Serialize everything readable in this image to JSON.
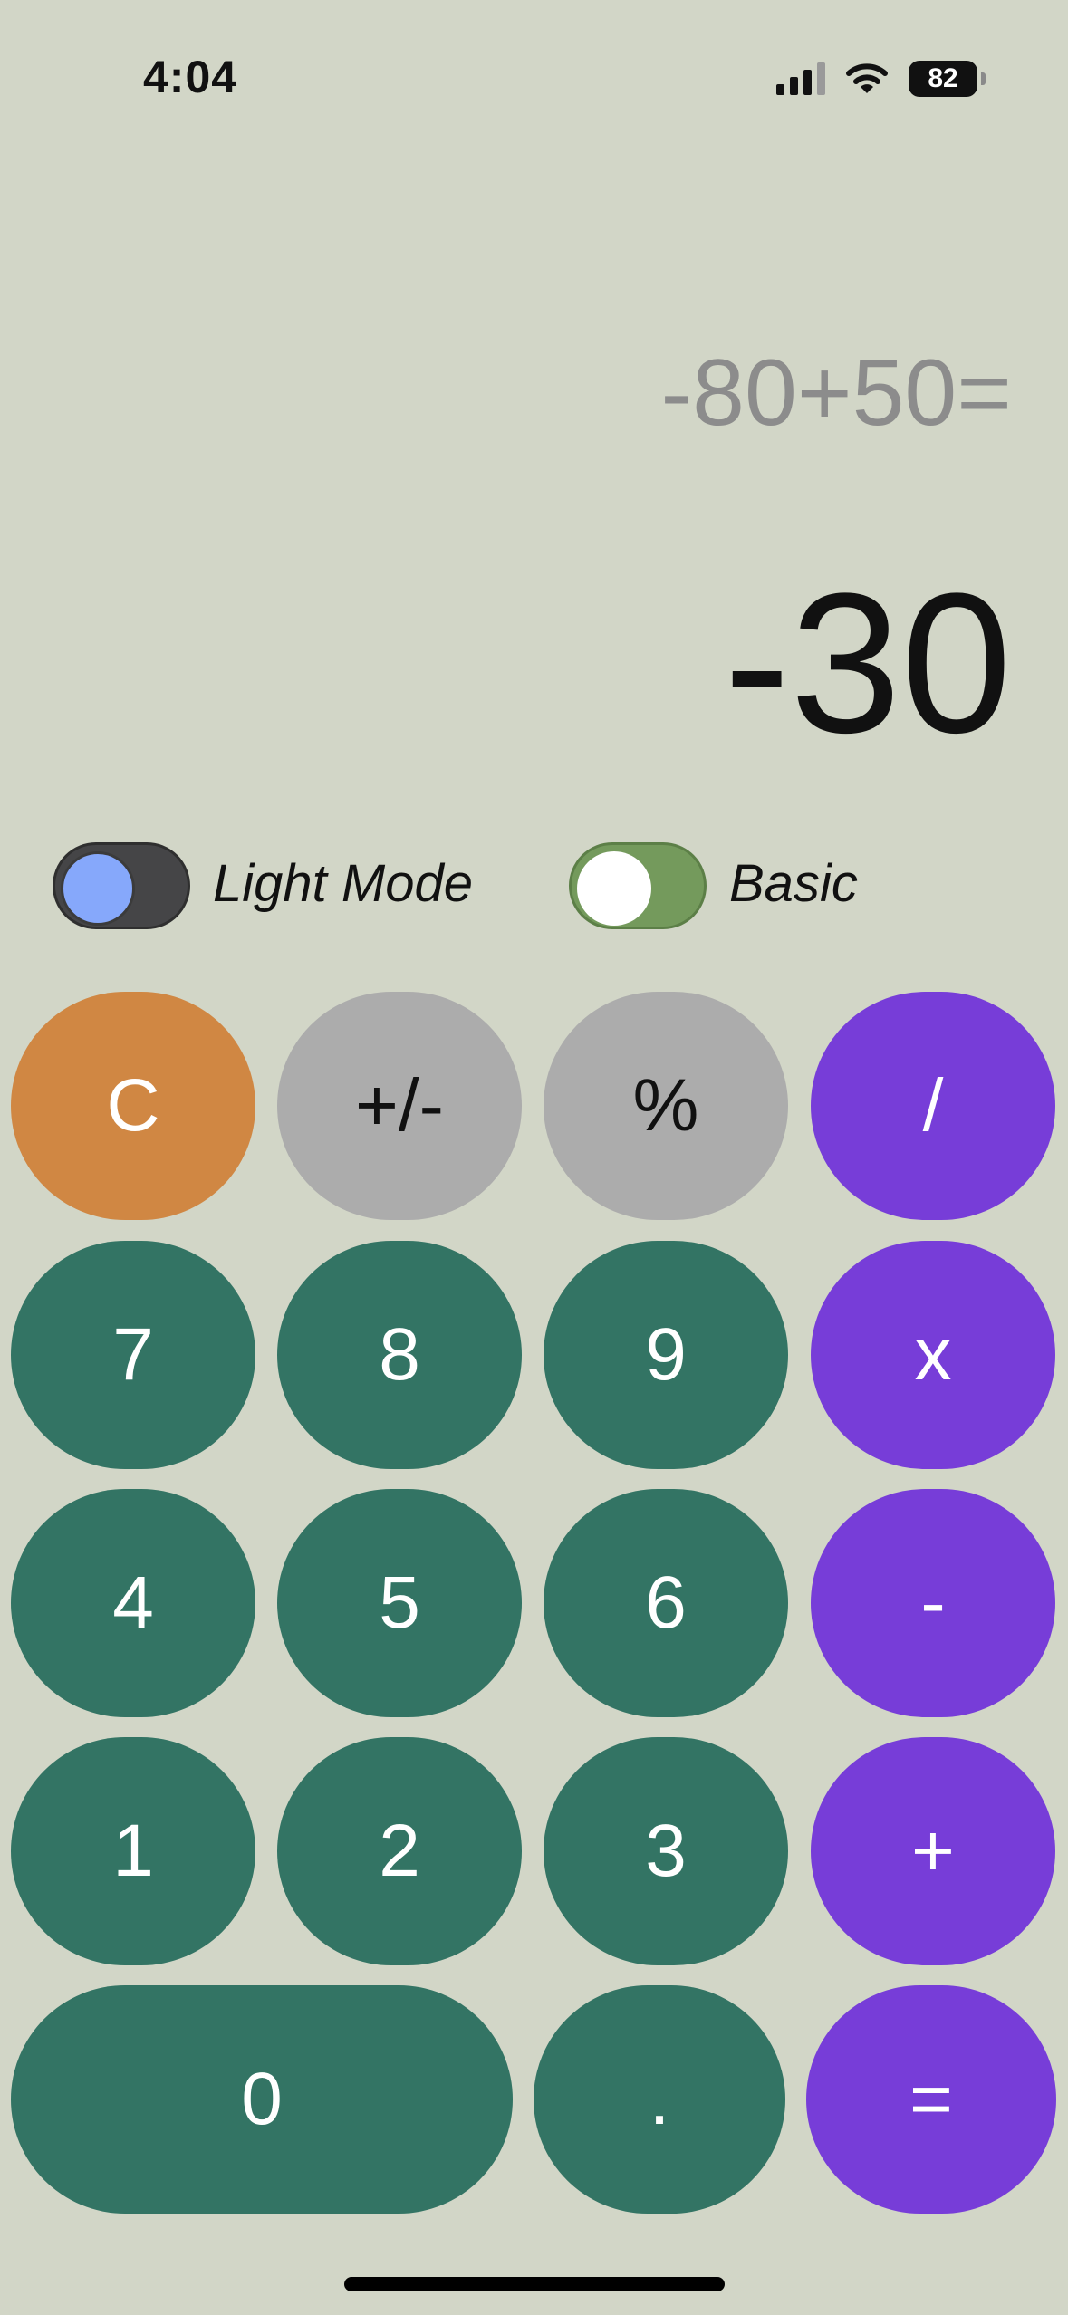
{
  "status_bar": {
    "time": "4:04",
    "battery": "82",
    "signal_icon": "cellular-signal-icon",
    "wifi_icon": "wifi-icon",
    "battery_icon": "battery-icon"
  },
  "display": {
    "expression": "-80+50=",
    "result": "-30"
  },
  "toggles": {
    "theme": {
      "label": "Light Mode",
      "knob_color": "#86a8fb",
      "track_color": "#454547"
    },
    "mode": {
      "label": "Basic",
      "knob_color": "#ffffff",
      "track_color": "#749a5c"
    }
  },
  "colors": {
    "background": "#d2d6c7",
    "clear": "#d08743",
    "function": "#acacac",
    "digit": "#337464",
    "operator": "#773dd8"
  },
  "keys": {
    "clear": "C",
    "sign": "+/-",
    "percent": "%",
    "divide": "/",
    "seven": "7",
    "eight": "8",
    "nine": "9",
    "multiply": "x",
    "four": "4",
    "five": "5",
    "six": "6",
    "subtract": "-",
    "one": "1",
    "two": "2",
    "three": "3",
    "add": "+",
    "zero": "0",
    "decimal": ".",
    "equals": "="
  }
}
